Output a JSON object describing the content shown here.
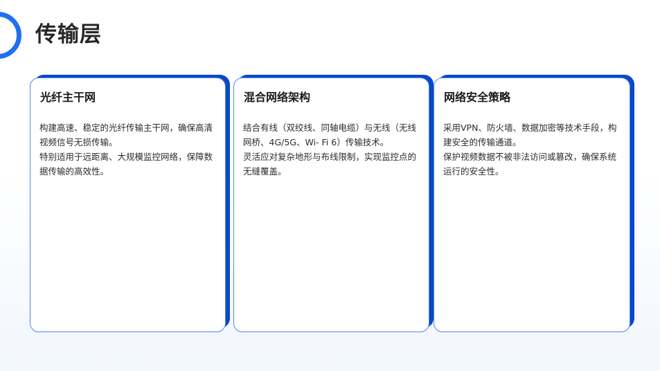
{
  "page": {
    "title": "传输层"
  },
  "cards": [
    {
      "title": "光纤主干网",
      "paragraphs": [
        "构建高速、稳定的光纤传输主干网，确保高清视频信号无损传输。",
        "特别适用于远距离、大规模监控网络，保障数据传输的高效性。"
      ]
    },
    {
      "title": "混合网络架构",
      "paragraphs": [
        "结合有线（双绞线、同轴电缆）与无线（无线网桥、4G/5G、Wi- Fi 6）传输技术。",
        "灵活应对复杂地形与布线限制，实现监控点的无缝覆盖。"
      ]
    },
    {
      "title": "网络安全策略",
      "paragraphs": [
        "采用VPN、防火墙、数据加密等技术手段，构建安全的传输通道。",
        "保护视频数据不被非法访问或篡改，确保系统运行的安全性。"
      ]
    }
  ],
  "colors": {
    "accent": "#1f6ff0",
    "card_shadow": "#0a49c8",
    "card_border": "#4a86f2"
  }
}
